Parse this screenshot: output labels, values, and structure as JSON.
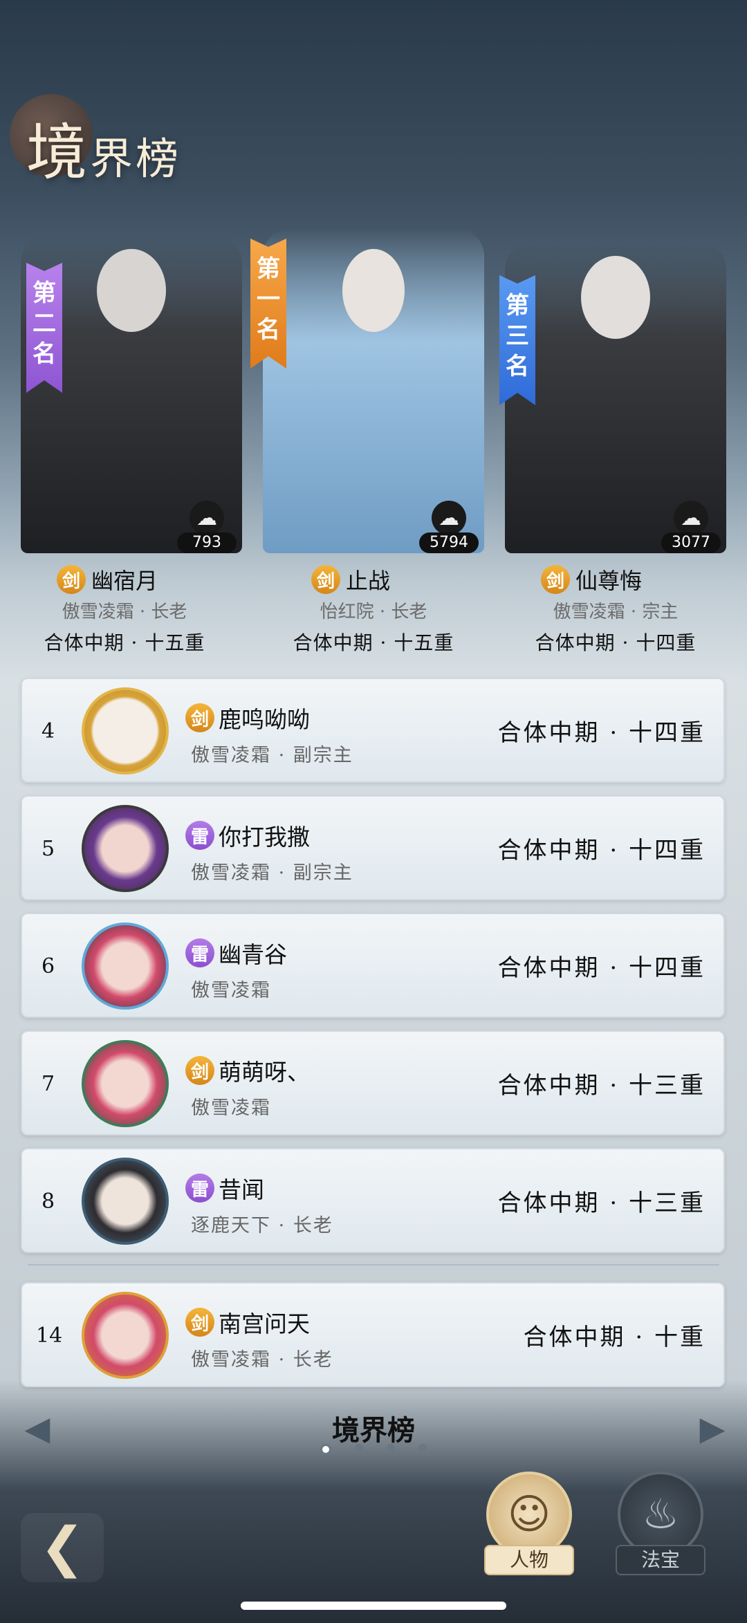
{
  "title": {
    "big": "境",
    "rest": "界榜"
  },
  "podium": [
    {
      "banner": [
        "第",
        "二",
        "名"
      ],
      "score": "793",
      "name": "幽宿月",
      "sect": "剑",
      "guild": "傲雪凌霜 · 长老",
      "level": "合体中期 · 十五重"
    },
    {
      "banner": [
        "第",
        "一",
        "名"
      ],
      "score": "5794",
      "name": "止战",
      "sect": "剑",
      "guild": "怡红院 · 长老",
      "level": "合体中期 · 十五重"
    },
    {
      "banner": [
        "第",
        "三",
        "名"
      ],
      "score": "3077",
      "name": "仙尊悔",
      "sect": "剑",
      "guild": "傲雪凌霜 · 宗主",
      "level": "合体中期 · 十四重"
    }
  ],
  "rows": [
    {
      "rank": "4",
      "sect": "剑",
      "name": "鹿鸣呦呦",
      "guild": "傲雪凌霜 · 副宗主",
      "level": "合体中期 · 十四重"
    },
    {
      "rank": "5",
      "sect": "雷",
      "name": "你打我撒",
      "guild": "傲雪凌霜 · 副宗主",
      "level": "合体中期 · 十四重"
    },
    {
      "rank": "6",
      "sect": "雷",
      "name": "幽青谷",
      "guild": "傲雪凌霜",
      "level": "合体中期 · 十四重"
    },
    {
      "rank": "7",
      "sect": "剑",
      "name": "萌萌呀、",
      "guild": "傲雪凌霜",
      "level": "合体中期 · 十三重"
    },
    {
      "rank": "8",
      "sect": "雷",
      "name": "昔闻",
      "guild": "逐鹿天下 · 长老",
      "level": "合体中期 · 十三重"
    }
  ],
  "self_row": {
    "rank": "14",
    "sect": "剑",
    "name": "南宫问天",
    "guild": "傲雪凌霜 · 长老",
    "level": "合体中期 · 十重"
  },
  "footer": {
    "title": "境界榜",
    "page_index": 1,
    "page_count": 4
  },
  "tabs": {
    "character": "人物",
    "treasure": "法宝"
  },
  "icons": {
    "back": "back-icon",
    "left": "arrow-left-icon",
    "right": "arrow-right-icon",
    "score": "flame-icon"
  },
  "colors": {
    "sword": "#e8a22a",
    "thunder": "#9c63d8",
    "rank1": "#f08a2c",
    "rank2": "#9b62d8",
    "rank3": "#3f7fe0"
  }
}
